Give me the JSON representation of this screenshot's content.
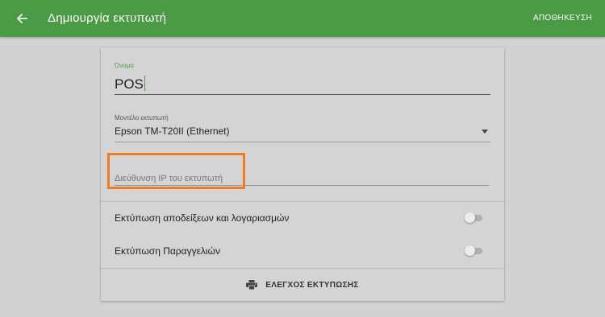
{
  "appbar": {
    "title": "Δημιουργία εκτυπωτή",
    "save_label": "ΑΠΟΘΗΚΕΥΣΗ",
    "color": "#4a9a46"
  },
  "form": {
    "name": {
      "label": "Όνομα",
      "value": "POS"
    },
    "model": {
      "label": "Μοντέλο εκτυπωτή",
      "selected": "Epson TM-T20II (Ethernet)"
    },
    "ip": {
      "placeholder": "Διεύθυνση IP του εκτυπωτή",
      "value": "",
      "highlight_color": "#f07b20"
    }
  },
  "toggles": [
    {
      "label": "Εκτύπωση αποδείξεων και λογαριασμών",
      "checked": false
    },
    {
      "label": "Εκτύπωση Παραγγελιών",
      "checked": false
    }
  ],
  "test_print": {
    "label": "ΕΛΕΓΧΟΣ ΕΚΤΥΠΩΣΗΣ",
    "icon": "printer-icon"
  }
}
